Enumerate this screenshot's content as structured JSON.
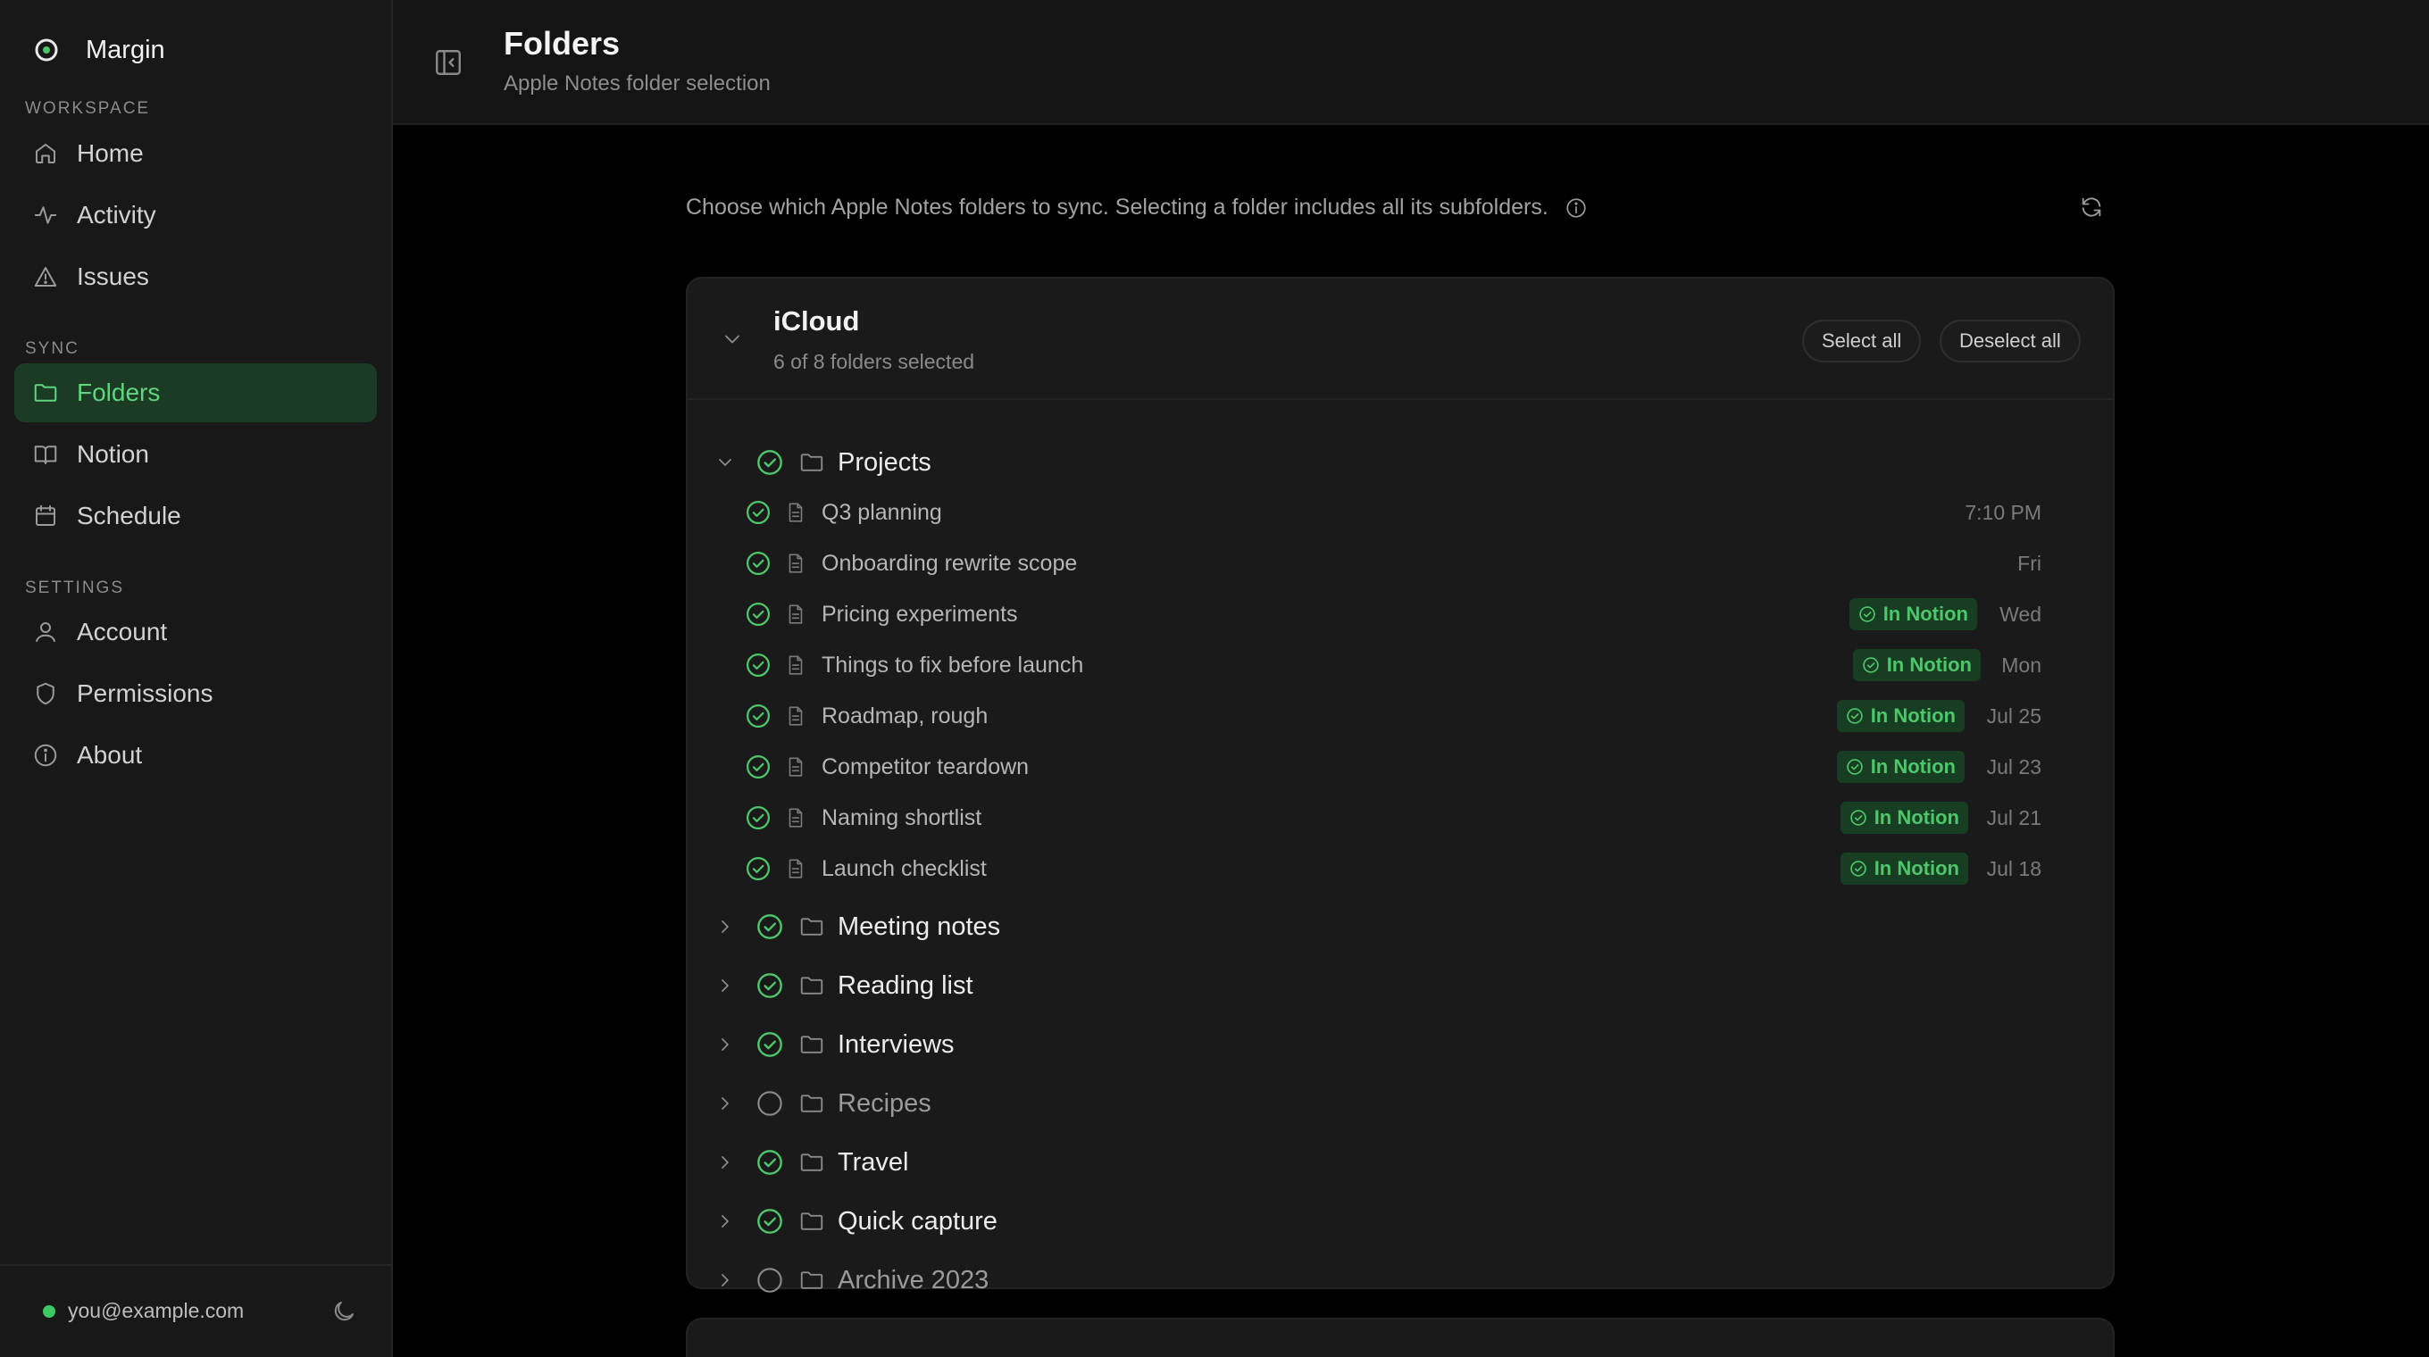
{
  "app": {
    "name": "Margin"
  },
  "sidebar": {
    "workspace_label": "WORKSPACE",
    "sync_label": "SYNC",
    "settings_label": "SETTINGS",
    "items": [
      {
        "label": "Home",
        "icon": "home-icon"
      },
      {
        "label": "Activity",
        "icon": "activity-icon"
      },
      {
        "label": "Issues",
        "icon": "warning-icon"
      },
      {
        "label": "Folders",
        "icon": "folder-icon",
        "active": true
      },
      {
        "label": "Notion",
        "icon": "book-icon"
      },
      {
        "label": "Schedule",
        "icon": "calendar-icon"
      },
      {
        "label": "Account",
        "icon": "user-icon"
      },
      {
        "label": "Permissions",
        "icon": "shield-icon"
      },
      {
        "label": "About",
        "icon": "info-icon"
      }
    ],
    "user_email": "you@example.com"
  },
  "header": {
    "title": "Folders",
    "subtitle": "Apple Notes folder selection"
  },
  "main": {
    "intro": "Choose which Apple Notes folders to sync. Selecting a folder includes all its subfolders."
  },
  "account": {
    "name": "iCloud",
    "summary": "6 of 8 folders selected",
    "select_all": "Select all",
    "deselect_all": "Deselect all",
    "folders": [
      {
        "name": "Projects",
        "selected": true,
        "expanded": true
      },
      {
        "name": "Meeting notes",
        "selected": true
      },
      {
        "name": "Reading list",
        "selected": true
      },
      {
        "name": "Interviews",
        "selected": true
      },
      {
        "name": "Recipes",
        "selected": false
      },
      {
        "name": "Travel",
        "selected": true
      },
      {
        "name": "Quick capture",
        "selected": true
      },
      {
        "name": "Archive 2023",
        "selected": false
      }
    ],
    "notes": [
      {
        "title": "Q3 planning",
        "date": "7:10 PM",
        "in_notion": false
      },
      {
        "title": "Onboarding rewrite scope",
        "date": "Fri",
        "in_notion": false
      },
      {
        "title": "Pricing experiments",
        "date": "Wed",
        "in_notion": true
      },
      {
        "title": "Things to fix before launch",
        "date": "Mon",
        "in_notion": true
      },
      {
        "title": "Roadmap, rough",
        "date": "Jul 25",
        "in_notion": true
      },
      {
        "title": "Competitor teardown",
        "date": "Jul 23",
        "in_notion": true
      },
      {
        "title": "Naming shortlist",
        "date": "Jul 21",
        "in_notion": true
      },
      {
        "title": "Launch checklist",
        "date": "Jul 18",
        "in_notion": true
      }
    ],
    "badge_label": "In Notion"
  },
  "colors": {
    "accent": "#4ec76b",
    "active_nav_bg": "#1b3b25",
    "card_bg": "#1a1a1a",
    "page_bg": "#000000"
  }
}
